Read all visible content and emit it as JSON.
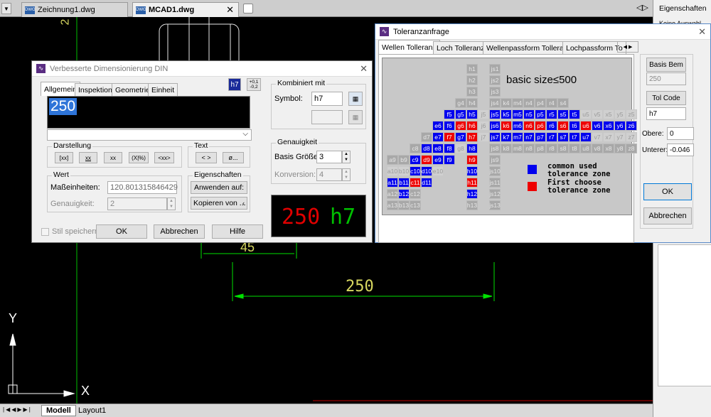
{
  "tabs": {
    "doc1": "Zeichnung1.dwg",
    "doc2": "MCAD1.dwg",
    "menu_arrow": "▼"
  },
  "right_panel": {
    "title": "Eigenschaften",
    "selection": "Keine Auswahl"
  },
  "status": {
    "model": "Modell",
    "layout1": "Layout1"
  },
  "canvas": {
    "dim_250": "250",
    "dim_45": "45",
    "dim_250_bottom": "250",
    "axis_y": "Y",
    "axis_x": "X",
    "side_label": "2"
  },
  "dim_dialog": {
    "title": "Verbesserte Dimensionierung DIN",
    "tabs": [
      "Allgemein",
      "Inspektion",
      "Geometrie",
      "Einheit"
    ],
    "toggle_h7": "h7",
    "toggle_tol_top": "+0,1",
    "toggle_tol_bot": "-0,2",
    "text_value": "250",
    "darstellung": {
      "label": "Darstellung",
      "buttons": [
        "[xx]",
        "xx",
        "xx",
        "(X|%)",
        "<xx>"
      ]
    },
    "text_group": {
      "label": "Text",
      "buttons": [
        "< >",
        "ø..."
      ]
    },
    "wert": {
      "label": "Wert",
      "mass_label": "Maßeinheiten:",
      "mass_value": "120.801315846429",
      "genau_label": "Genauigkeit:",
      "genau_value": "2"
    },
    "eigenschaften": {
      "label": "Eigenschaften",
      "apply": "Anwenden auf:",
      "copy": "Kopieren von ..."
    },
    "kombiniert": {
      "label": "Kombiniert mit",
      "symbol_label": "Symbol:",
      "symbol_value": "h7"
    },
    "genauigkeit": {
      "label": "Genauigkeit",
      "basis_label": "Basis Größen:",
      "basis_value": "3",
      "konv_label": "Konversion:",
      "konv_value": "4"
    },
    "preview_num": "250",
    "preview_tol": "h7",
    "stil": "Stil speichern",
    "ok": "OK",
    "cancel": "Abbrechen",
    "help": "Hilfe"
  },
  "tol_dialog": {
    "title": "Toleranzanfrage",
    "tabs": [
      "Wellen Tolleranz",
      "Loch Tolleranz",
      "Wellenpassform Tolleranz",
      "Lochpassform To"
    ],
    "heading": "basic size≤500",
    "legend1a": "common used",
    "legend1b": "tolerance zone",
    "legend2a": "First choose",
    "legend2b": "tolerance zone",
    "basis_btn": "Basis Bem",
    "basis_val": "250",
    "tolcode_btn": "Tol Code",
    "tolcode_val": "h7",
    "obere_lbl": "Obere:",
    "obere_val": "0",
    "unterer_lbl": "Unterer:",
    "unterer_val": "-0.046",
    "ok": "OK",
    "cancel": "Abbrechen"
  },
  "tol_grid": [
    {
      "t": "h1",
      "c": "g",
      "col": 7,
      "row": 0
    },
    {
      "t": "js1",
      "c": "g",
      "col": 9,
      "row": 0
    },
    {
      "t": "h2",
      "c": "g",
      "col": 7,
      "row": 1
    },
    {
      "t": "js2",
      "c": "g",
      "col": 9,
      "row": 1
    },
    {
      "t": "h3",
      "c": "g",
      "col": 7,
      "row": 2
    },
    {
      "t": "js3",
      "c": "g",
      "col": 9,
      "row": 2
    },
    {
      "t": "g4",
      "c": "g",
      "col": 6,
      "row": 3
    },
    {
      "t": "h4",
      "c": "g",
      "col": 7,
      "row": 3
    },
    {
      "t": "js4",
      "c": "g",
      "col": 9,
      "row": 3
    },
    {
      "t": "k4",
      "c": "g",
      "col": 10,
      "row": 3
    },
    {
      "t": "m4",
      "c": "g",
      "col": 11,
      "row": 3
    },
    {
      "t": "n4",
      "c": "g",
      "col": 12,
      "row": 3
    },
    {
      "t": "p4",
      "c": "g",
      "col": 13,
      "row": 3
    },
    {
      "t": "r4",
      "c": "g",
      "col": 14,
      "row": 3
    },
    {
      "t": "s4",
      "c": "g",
      "col": 15,
      "row": 3
    },
    {
      "t": "f5",
      "c": "b",
      "col": 5,
      "row": 4
    },
    {
      "t": "g5",
      "c": "b",
      "col": 6,
      "row": 4
    },
    {
      "t": "h5",
      "c": "b",
      "col": 7,
      "row": 4
    },
    {
      "t": "j5",
      "c": "l",
      "col": 8,
      "row": 4
    },
    {
      "t": "js5",
      "c": "b",
      "col": 9,
      "row": 4
    },
    {
      "t": "k5",
      "c": "b",
      "col": 10,
      "row": 4
    },
    {
      "t": "m5",
      "c": "b",
      "col": 11,
      "row": 4
    },
    {
      "t": "n5",
      "c": "b",
      "col": 12,
      "row": 4
    },
    {
      "t": "p5",
      "c": "b",
      "col": 13,
      "row": 4
    },
    {
      "t": "r5",
      "c": "b",
      "col": 14,
      "row": 4
    },
    {
      "t": "s5",
      "c": "b",
      "col": 15,
      "row": 4
    },
    {
      "t": "t5",
      "c": "b",
      "col": 16,
      "row": 4
    },
    {
      "t": "u5",
      "c": "l",
      "col": 17,
      "row": 4
    },
    {
      "t": "v5",
      "c": "l",
      "col": 18,
      "row": 4
    },
    {
      "t": "x5",
      "c": "l",
      "col": 19,
      "row": 4
    },
    {
      "t": "y5",
      "c": "l",
      "col": 20,
      "row": 4
    },
    {
      "t": "z5",
      "c": "l",
      "col": 21,
      "row": 4
    },
    {
      "t": "e6",
      "c": "b",
      "col": 4,
      "row": 5
    },
    {
      "t": "f6",
      "c": "b",
      "col": 5,
      "row": 5
    },
    {
      "t": "g6",
      "c": "r",
      "col": 6,
      "row": 5
    },
    {
      "t": "h6",
      "c": "r",
      "col": 7,
      "row": 5
    },
    {
      "t": "j6",
      "c": "l",
      "col": 8,
      "row": 5
    },
    {
      "t": "js6",
      "c": "b",
      "col": 9,
      "row": 5
    },
    {
      "t": "k6",
      "c": "r",
      "col": 10,
      "row": 5
    },
    {
      "t": "m6",
      "c": "b",
      "col": 11,
      "row": 5
    },
    {
      "t": "n6",
      "c": "r",
      "col": 12,
      "row": 5
    },
    {
      "t": "p6",
      "c": "r",
      "col": 13,
      "row": 5
    },
    {
      "t": "r6",
      "c": "b",
      "col": 14,
      "row": 5
    },
    {
      "t": "s6",
      "c": "r",
      "col": 15,
      "row": 5
    },
    {
      "t": "t6",
      "c": "b",
      "col": 16,
      "row": 5
    },
    {
      "t": "u6",
      "c": "r",
      "col": 17,
      "row": 5
    },
    {
      "t": "v6",
      "c": "b",
      "col": 18,
      "row": 5
    },
    {
      "t": "x6",
      "c": "b",
      "col": 19,
      "row": 5
    },
    {
      "t": "y6",
      "c": "b",
      "col": 20,
      "row": 5
    },
    {
      "t": "z6",
      "c": "b",
      "col": 21,
      "row": 5
    },
    {
      "t": "d7",
      "c": "g",
      "col": 3,
      "row": 6
    },
    {
      "t": "e7",
      "c": "b",
      "col": 4,
      "row": 6
    },
    {
      "t": "f7",
      "c": "r",
      "col": 5,
      "row": 6
    },
    {
      "t": "g7",
      "c": "b",
      "col": 6,
      "row": 6
    },
    {
      "t": "h7",
      "c": "r",
      "col": 7,
      "row": 6
    },
    {
      "t": "j7",
      "c": "l",
      "col": 8,
      "row": 6
    },
    {
      "t": "js7",
      "c": "b",
      "col": 9,
      "row": 6
    },
    {
      "t": "k7",
      "c": "b",
      "col": 10,
      "row": 6
    },
    {
      "t": "m7",
      "c": "b",
      "col": 11,
      "row": 6
    },
    {
      "t": "n7",
      "c": "b",
      "col": 12,
      "row": 6
    },
    {
      "t": "p7",
      "c": "b",
      "col": 13,
      "row": 6
    },
    {
      "t": "r7",
      "c": "b",
      "col": 14,
      "row": 6
    },
    {
      "t": "s7",
      "c": "b",
      "col": 15,
      "row": 6
    },
    {
      "t": "t7",
      "c": "b",
      "col": 16,
      "row": 6
    },
    {
      "t": "u7",
      "c": "b",
      "col": 17,
      "row": 6
    },
    {
      "t": "v7",
      "c": "l",
      "col": 18,
      "row": 6
    },
    {
      "t": "x7",
      "c": "l",
      "col": 19,
      "row": 6
    },
    {
      "t": "y7",
      "c": "l",
      "col": 20,
      "row": 6
    },
    {
      "t": "z7",
      "c": "l",
      "col": 21,
      "row": 6
    },
    {
      "t": "c8",
      "c": "g",
      "col": 2,
      "row": 7
    },
    {
      "t": "d8",
      "c": "b",
      "col": 3,
      "row": 7
    },
    {
      "t": "e8",
      "c": "b",
      "col": 4,
      "row": 7
    },
    {
      "t": "f8",
      "c": "b",
      "col": 5,
      "row": 7
    },
    {
      "t": "g8",
      "c": "l",
      "col": 6,
      "row": 7
    },
    {
      "t": "h8",
      "c": "b",
      "col": 7,
      "row": 7
    },
    {
      "t": "js8",
      "c": "g",
      "col": 9,
      "row": 7
    },
    {
      "t": "k8",
      "c": "g",
      "col": 10,
      "row": 7
    },
    {
      "t": "m8",
      "c": "g",
      "col": 11,
      "row": 7
    },
    {
      "t": "n8",
      "c": "g",
      "col": 12,
      "row": 7
    },
    {
      "t": "p8",
      "c": "g",
      "col": 13,
      "row": 7
    },
    {
      "t": "r8",
      "c": "g",
      "col": 14,
      "row": 7
    },
    {
      "t": "s8",
      "c": "g",
      "col": 15,
      "row": 7
    },
    {
      "t": "t8",
      "c": "g",
      "col": 16,
      "row": 7
    },
    {
      "t": "u8",
      "c": "g",
      "col": 17,
      "row": 7
    },
    {
      "t": "v8",
      "c": "g",
      "col": 18,
      "row": 7
    },
    {
      "t": "x8",
      "c": "g",
      "col": 19,
      "row": 7
    },
    {
      "t": "y8",
      "c": "g",
      "col": 20,
      "row": 7
    },
    {
      "t": "z8",
      "c": "g",
      "col": 21,
      "row": 7
    },
    {
      "t": "a9",
      "c": "g",
      "col": 0,
      "row": 8
    },
    {
      "t": "b9",
      "c": "g",
      "col": 1,
      "row": 8
    },
    {
      "t": "c9",
      "c": "b",
      "col": 2,
      "row": 8
    },
    {
      "t": "d9",
      "c": "r",
      "col": 3,
      "row": 8
    },
    {
      "t": "e9",
      "c": "b",
      "col": 4,
      "row": 8
    },
    {
      "t": "f9",
      "c": "b",
      "col": 5,
      "row": 8
    },
    {
      "t": "h9",
      "c": "r",
      "col": 7,
      "row": 8
    },
    {
      "t": "js9",
      "c": "g",
      "col": 9,
      "row": 8
    },
    {
      "t": "a10",
      "c": "l",
      "col": 0,
      "row": 9
    },
    {
      "t": "b10",
      "c": "l",
      "col": 1,
      "row": 9
    },
    {
      "t": "c10",
      "c": "b",
      "col": 2,
      "row": 9
    },
    {
      "t": "d10",
      "c": "b",
      "col": 3,
      "row": 9
    },
    {
      "t": "e10",
      "c": "l",
      "col": 4,
      "row": 9
    },
    {
      "t": "h10",
      "c": "b",
      "col": 7,
      "row": 9
    },
    {
      "t": "js10",
      "c": "g",
      "col": 9,
      "row": 9
    },
    {
      "t": "a11",
      "c": "b",
      "col": 0,
      "row": 10
    },
    {
      "t": "b11",
      "c": "b",
      "col": 1,
      "row": 10
    },
    {
      "t": "c11",
      "c": "r",
      "col": 2,
      "row": 10
    },
    {
      "t": "d11",
      "c": "b",
      "col": 3,
      "row": 10
    },
    {
      "t": "h11",
      "c": "r",
      "col": 7,
      "row": 10
    },
    {
      "t": "js11",
      "c": "g",
      "col": 9,
      "row": 10
    },
    {
      "t": "a12",
      "c": "g",
      "col": 0,
      "row": 11
    },
    {
      "t": "b12",
      "c": "b",
      "col": 1,
      "row": 11
    },
    {
      "t": "c12",
      "c": "g",
      "col": 2,
      "row": 11
    },
    {
      "t": "h12",
      "c": "b",
      "col": 7,
      "row": 11
    },
    {
      "t": "js12",
      "c": "g",
      "col": 9,
      "row": 11
    },
    {
      "t": "a13",
      "c": "g",
      "col": 0,
      "row": 12
    },
    {
      "t": "b13",
      "c": "g",
      "col": 1,
      "row": 12
    },
    {
      "t": "c13",
      "c": "g",
      "col": 2,
      "row": 12
    },
    {
      "t": "h13",
      "c": "g",
      "col": 7,
      "row": 12
    },
    {
      "t": "js13",
      "c": "g",
      "col": 9,
      "row": 12
    }
  ]
}
